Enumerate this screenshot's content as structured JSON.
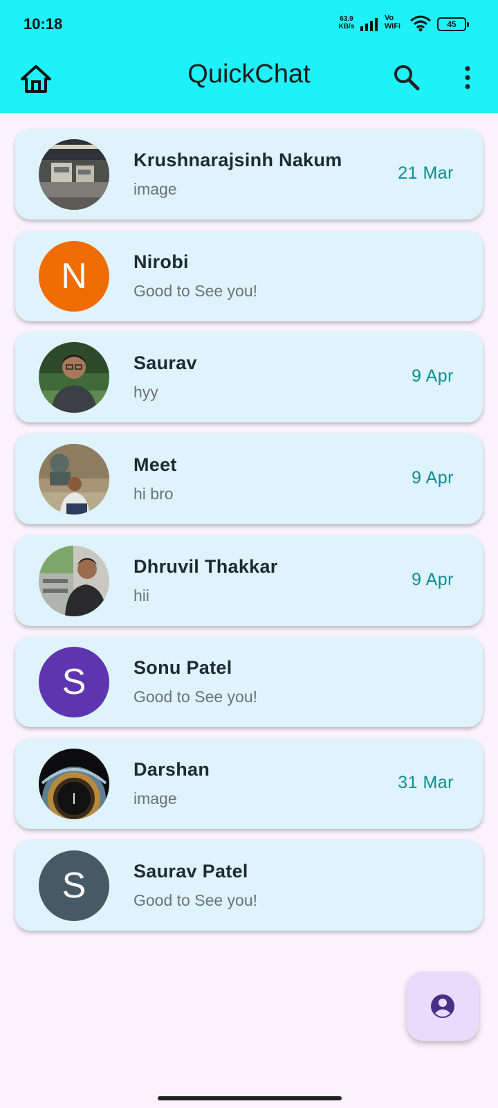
{
  "status_bar": {
    "time": "10:18",
    "net_speed_value": "63.9",
    "net_speed_unit": "KB/s",
    "vowifi_top": "Vo",
    "vowifi_bottom": "WiFi",
    "battery": "45"
  },
  "app_bar": {
    "title": "QuickChat",
    "icons": [
      "home-icon",
      "search-icon",
      "more-vert-icon"
    ],
    "background": "#1ef2f8"
  },
  "chats": [
    {
      "name": "Krushnarajsinh Nakum",
      "message": "image",
      "date": "21 Mar",
      "avatar": "photo-bus"
    },
    {
      "name": "Nirobi",
      "message": "Good to See you!",
      "date": "",
      "avatar": "letter",
      "letter": "N",
      "avatar_color": "#ef6c00"
    },
    {
      "name": "Saurav",
      "message": "hyy",
      "date": "9 Apr",
      "avatar": "photo-person"
    },
    {
      "name": "Meet",
      "message": "hi bro",
      "date": "9 Apr",
      "avatar": "photo-statue"
    },
    {
      "name": "Dhruvil Thakkar",
      "message": "hii",
      "date": "9 Apr",
      "avatar": "photo-person-outdoor"
    },
    {
      "name": "Sonu Patel",
      "message": "Good to See you!",
      "date": "",
      "avatar": "letter",
      "letter": "S",
      "avatar_color": "#5e35b1"
    },
    {
      "name": "Darshan",
      "message": "image",
      "date": "31 Mar",
      "avatar": "photo-ceiling"
    },
    {
      "name": "Saurav Patel",
      "message": "Good to See you!",
      "date": "",
      "avatar": "letter",
      "letter": "S",
      "avatar_color": "#455a64"
    }
  ],
  "fab": {
    "icon": "account-circle-icon",
    "color": "#e7dcfb"
  },
  "colors": {
    "card": "#dff3fc",
    "date": "#0b8d94",
    "page": "#fbf3fb"
  }
}
